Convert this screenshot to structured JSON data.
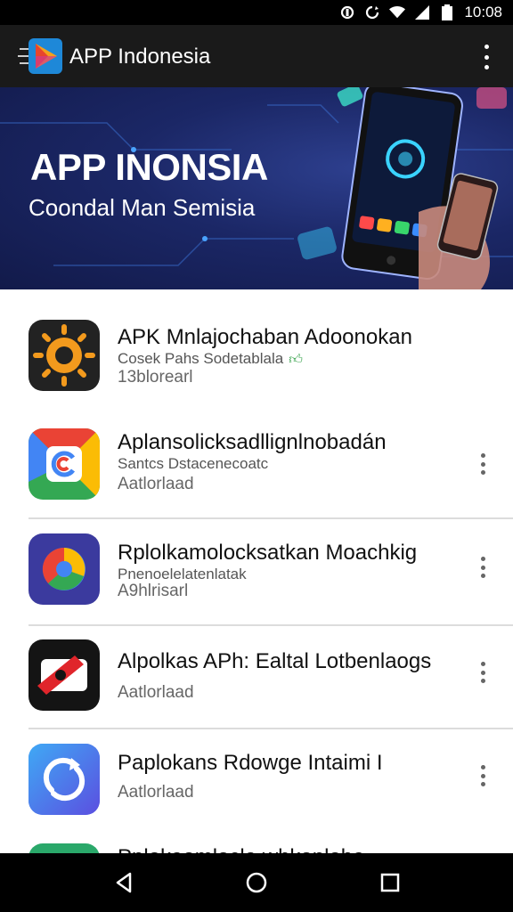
{
  "status_bar": {
    "time": "10:08",
    "icons": [
      "data-saver-icon",
      "sync-icon",
      "wifi-icon",
      "cellular-signal-icon",
      "battery-icon"
    ]
  },
  "app_bar": {
    "title": "APP Indonesia",
    "logo_icon": "app-indonesia-logo",
    "menu_icon": "overflow-menu-icon"
  },
  "banner": {
    "title": "APP INONSIA",
    "subtitle": "Coondal Man Semisia",
    "background_color": "#1b2766"
  },
  "apps": [
    {
      "title": "APK Mnlajochaban Adoonokan",
      "sub1": "Cosek Pahs Sodetablala",
      "sub2": "13blorearl",
      "verified": true,
      "icon": "orange-sun-icon",
      "menu": false
    },
    {
      "title": "Aplansolicksadllignlnobadán",
      "sub1": "Santcs Dstacenecoatc",
      "sub2": "Aatlorlaad",
      "verified": false,
      "icon": "google-c-icon",
      "menu": true
    },
    {
      "title": "Rplolkamolocksatkan Moachkig",
      "sub1": "Pnenoelelatenlatak",
      "sub2": "A9hlrisarl",
      "verified": false,
      "icon": "chrome-swirl-icon",
      "menu": true
    },
    {
      "title": "Alpolkas APh: Ealtal Lotbenlaogs",
      "sub1": "",
      "sub2": "Aatlorlaad",
      "verified": false,
      "icon": "red-flag-icon",
      "menu": true
    },
    {
      "title": "Paplokans Rdowge Intaimi I",
      "sub1": "",
      "sub2": "Aatlorlaad",
      "verified": false,
      "icon": "blue-sync-icon",
      "menu": true
    },
    {
      "title": "Pplokaomlocla whkonloba",
      "sub1": "",
      "sub2": "",
      "verified": false,
      "icon": "partial-app-icon",
      "menu": false
    }
  ],
  "nav_bar": {
    "icons": [
      "back-icon",
      "home-icon",
      "recents-icon"
    ]
  },
  "colors": {
    "app_bar": "#1a1a1a",
    "status_bar": "#000000",
    "verified_green": "#2f9e44"
  }
}
